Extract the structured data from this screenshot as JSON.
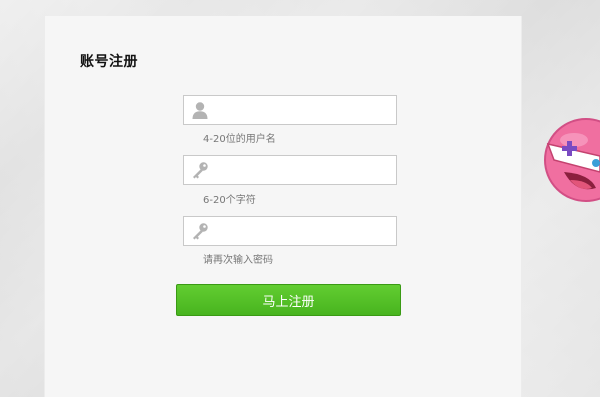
{
  "form": {
    "title": "账号注册",
    "fields": [
      {
        "icon": "user-icon",
        "value": "",
        "hint": "4-20位的用户名"
      },
      {
        "icon": "key-icon",
        "value": "",
        "hint": "6-20个字符"
      },
      {
        "icon": "key-icon",
        "value": "",
        "hint": "请再次输入密码"
      }
    ],
    "submit_label": "马上注册"
  },
  "colors": {
    "submit_green": "#52c025",
    "mascot_pink": "#f06fa0"
  }
}
